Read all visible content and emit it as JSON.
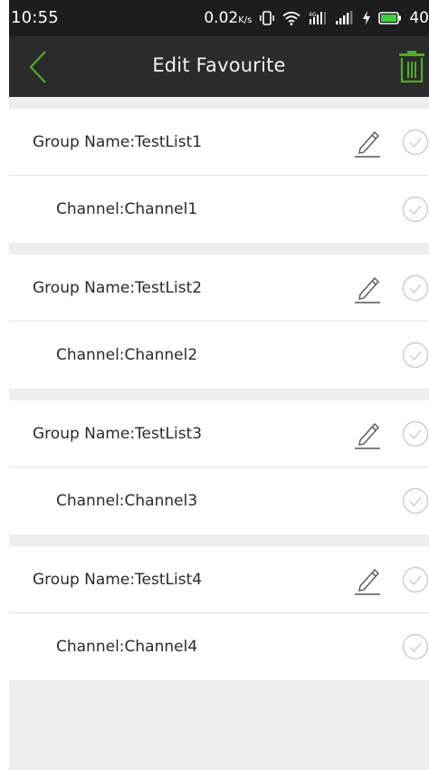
{
  "status_bar": {
    "time": "10:55",
    "speed_value": "0.02",
    "speed_unit": "K/s",
    "battery_text": "40",
    "icons": [
      "vibrate-icon",
      "wifi-icon",
      "signal-4g-icon",
      "signal-icon",
      "charging-icon",
      "battery-icon"
    ]
  },
  "header": {
    "title": "Edit Favourite",
    "back_icon": "chevron-left-icon",
    "delete_icon": "trash-icon"
  },
  "groups": [
    {
      "group_label": "Group Name:TestList1",
      "channel_label": "Channel:Channel1"
    },
    {
      "group_label": "Group Name:TestList2",
      "channel_label": "Channel:Channel2"
    },
    {
      "group_label": "Group Name:TestList3",
      "channel_label": "Channel:Channel3"
    },
    {
      "group_label": "Group Name:TestList4",
      "channel_label": "Channel:Channel4"
    }
  ],
  "colors": {
    "accent": "#4caf1f",
    "status_bar": "#1d1d1d",
    "app_bar": "#2b2b2b",
    "background": "#ededed",
    "row": "#ffffff",
    "check_outline": "#cccccc"
  }
}
